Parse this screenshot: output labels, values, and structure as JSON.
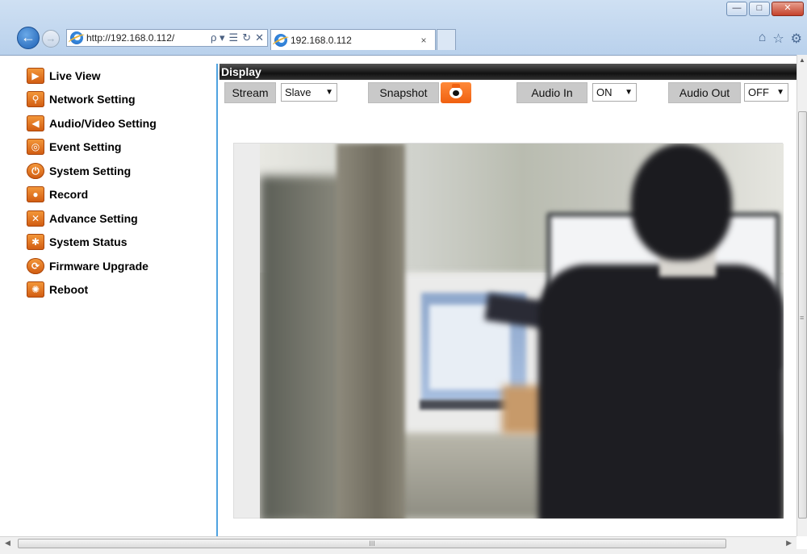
{
  "browser": {
    "url": "http://192.168.0.112/",
    "tab_title": "192.168.0.112",
    "tab_close": "×",
    "address_tools": [
      "ρ ▾",
      "☰",
      "↻",
      "✕"
    ],
    "right_tools": [
      "home-icon",
      "star-icon",
      "gear-icon"
    ]
  },
  "sidebar": {
    "items": [
      {
        "label": "Live View",
        "icon": "live-view-icon"
      },
      {
        "label": "Network Setting",
        "icon": "network-icon"
      },
      {
        "label": "Audio/Video Setting",
        "icon": "audio-video-icon"
      },
      {
        "label": "Event Setting",
        "icon": "event-icon"
      },
      {
        "label": "System Setting",
        "icon": "system-icon"
      },
      {
        "label": "Record",
        "icon": "record-icon"
      },
      {
        "label": "Advance Setting",
        "icon": "advance-icon"
      },
      {
        "label": "System Status",
        "icon": "status-icon"
      },
      {
        "label": "Firmware Upgrade",
        "icon": "firmware-icon"
      },
      {
        "label": "Reboot",
        "icon": "reboot-icon"
      }
    ]
  },
  "main": {
    "header": "Display",
    "toolbar": {
      "stream_label": "Stream",
      "stream_value": "Slave",
      "snapshot_label": "Snapshot",
      "audio_in_label": "Audio In",
      "audio_in_value": "ON",
      "audio_out_label": "Audio Out",
      "audio_out_value": "OFF"
    }
  },
  "scrollbar": {
    "h_thumb_grip": "III"
  },
  "colors": {
    "accent_orange": "#f06010",
    "sidebar_border": "#4fa3e0",
    "header_bg": "#111111"
  }
}
